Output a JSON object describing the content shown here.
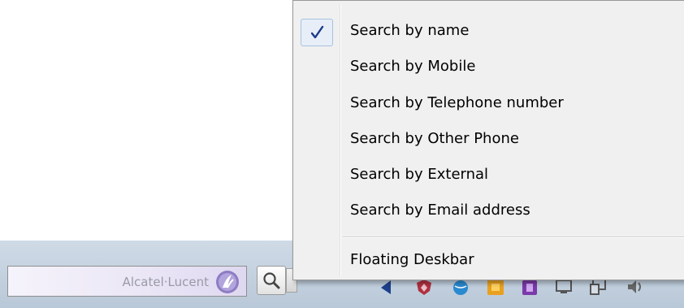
{
  "deskbar": {
    "brand_name": "Alcatel·Lucent",
    "logo_icon": "alcatel-lucent-logo-icon",
    "search_icon": "magnifier-icon"
  },
  "context_menu": {
    "items": [
      {
        "label": "Search by name",
        "checked": true
      },
      {
        "label": "Search by Mobile",
        "checked": false
      },
      {
        "label": "Search by Telephone number",
        "checked": false
      },
      {
        "label": "Search by Other Phone",
        "checked": false
      },
      {
        "label": "Search by External",
        "checked": false
      },
      {
        "label": "Search by Email address",
        "checked": false
      }
    ],
    "floating_label": "Floating Deskbar",
    "check_icon": "checkmark-icon"
  },
  "tray": {
    "icons": [
      "network-icon",
      "shield-icon",
      "globe-icon",
      "orange-app-icon",
      "purple-app-icon",
      "monitor-icon",
      "display-icon",
      "volume-icon"
    ]
  },
  "colors": {
    "taskbar": "#c4d1df",
    "menu_background": "#f0f0f0",
    "check_color": "#1a3a8a",
    "brand_purple": "#8e7cc3"
  }
}
